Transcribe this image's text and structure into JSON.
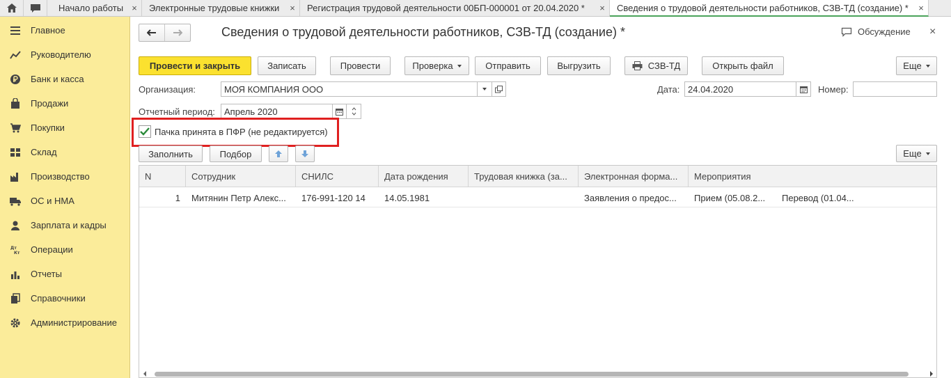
{
  "tabs": [
    {
      "label": "Начало работы"
    },
    {
      "label": "Электронные трудовые книжки"
    },
    {
      "label": "Регистрация трудовой деятельности 00БП-000001 от 20.04.2020 *"
    },
    {
      "label": "Сведения о трудовой деятельности работников, СЗВ-ТД (создание) *"
    }
  ],
  "sidebar": {
    "items": [
      {
        "label": "Главное",
        "icon": "menu-icon"
      },
      {
        "label": "Руководителю",
        "icon": "chart-icon"
      },
      {
        "label": "Банк и касса",
        "icon": "ruble-icon"
      },
      {
        "label": "Продажи",
        "icon": "bag-icon"
      },
      {
        "label": "Покупки",
        "icon": "cart-icon"
      },
      {
        "label": "Склад",
        "icon": "grid-icon"
      },
      {
        "label": "Производство",
        "icon": "factory-icon"
      },
      {
        "label": "ОС и НМА",
        "icon": "truck-icon"
      },
      {
        "label": "Зарплата и кадры",
        "icon": "person-icon"
      },
      {
        "label": "Операции",
        "icon": "dt-kt-icon"
      },
      {
        "label": "Отчеты",
        "icon": "bar-chart-icon"
      },
      {
        "label": "Справочники",
        "icon": "books-icon"
      },
      {
        "label": "Администрирование",
        "icon": "gear-icon"
      }
    ]
  },
  "document": {
    "title": "Сведения о трудовой деятельности работников, СЗВ-ТД (создание) *",
    "discussion": "Обсуждение"
  },
  "toolbar": {
    "post_close": "Провести и закрыть",
    "save": "Записать",
    "post": "Провести",
    "check": "Проверка",
    "send": "Отправить",
    "export": "Выгрузить",
    "szv_td": "СЗВ-ТД",
    "open_file": "Открыть файл",
    "more": "Еще"
  },
  "form": {
    "org_label": "Организация:",
    "org_value": "МОЯ КОМПАНИЯ ООО",
    "date_label": "Дата:",
    "date_value": "24.04.2020",
    "number_label": "Номер:",
    "number_value": "",
    "period_label": "Отчетный период:",
    "period_value": "Апрель 2020",
    "accepted_label": "Пачка принята в ПФР (не редактируется)",
    "accepted_checked": true
  },
  "table_toolbar": {
    "fill": "Заполнить",
    "select": "Подбор",
    "more": "Еще"
  },
  "table": {
    "columns": [
      "N",
      "Сотрудник",
      "СНИЛС",
      "Дата рождения",
      "Трудовая книжка (за...",
      "Электронная форма...",
      "Мероприятия"
    ],
    "rows": [
      [
        "1",
        "Митянин Петр Алекс...",
        "176-991-120 14",
        "14.05.1981",
        "",
        "Заявления о предос...",
        "Прием (05.08.2...",
        "Перевод (01.04..."
      ]
    ]
  },
  "colors": {
    "sidebar_bg": "#fbec9a",
    "primary_button": "#fbe12f",
    "highlight_frame": "#e02020",
    "active_tab_underline": "#4aa35a"
  }
}
